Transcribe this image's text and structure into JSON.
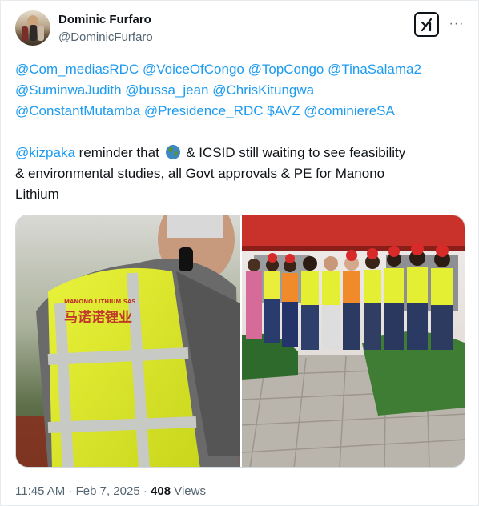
{
  "author": {
    "name": "Dominic Furfaro",
    "handle": "@DominicFurfaro"
  },
  "actions": {
    "grok_icon": "grok-icon",
    "more_icon": "more-icon",
    "more_label": "···"
  },
  "tweet": {
    "lines": [
      [
        {
          "t": "mention",
          "v": "@Com_mediasRDC"
        },
        {
          "t": "text",
          "v": " "
        },
        {
          "t": "mention",
          "v": "@VoiceOfCongo"
        },
        {
          "t": "text",
          "v": " "
        },
        {
          "t": "mention",
          "v": "@TopCongo"
        },
        {
          "t": "text",
          "v": " "
        },
        {
          "t": "mention",
          "v": "@TinaSalama2"
        }
      ],
      [
        {
          "t": "mention",
          "v": "@SuminwaJudith"
        },
        {
          "t": "text",
          "v": " "
        },
        {
          "t": "mention",
          "v": "@bussa_jean"
        },
        {
          "t": "text",
          "v": " "
        },
        {
          "t": "mention",
          "v": "@ChrisKitungwa"
        }
      ],
      [
        {
          "t": "mention",
          "v": "@ConstantMutamba"
        },
        {
          "t": "text",
          "v": " "
        },
        {
          "t": "mention",
          "v": "@Presidence_RDC"
        },
        {
          "t": "text",
          "v": " "
        },
        {
          "t": "mention",
          "v": "$AVZ"
        },
        {
          "t": "text",
          "v": " "
        },
        {
          "t": "mention",
          "v": "@cominiereSA"
        }
      ],
      [],
      [
        {
          "t": "mention",
          "v": "@kizpaka"
        },
        {
          "t": "text",
          "v": " reminder that "
        },
        {
          "t": "emoji",
          "v": "globe-emoji"
        },
        {
          "t": "text",
          "v": " & ICSID still waiting to see feasibility"
        }
      ],
      [
        {
          "t": "text",
          "v": "& environmental studies, all Govt approvals & PE for Manono"
        }
      ],
      [
        {
          "t": "text",
          "v": "Lithium"
        }
      ]
    ]
  },
  "media": {
    "left_vest_text": "马诺诺锂业",
    "left_vest_small": "MANONO LITHIUM SAS"
  },
  "meta": {
    "time": "11:45 AM",
    "sep": " · ",
    "date": "Feb 7, 2025",
    "sep2": " · ",
    "views_count": "408",
    "views_label": " Views"
  },
  "colors": {
    "link": "#1d9bf0",
    "secondary": "#536471",
    "primary": "#0f1419"
  }
}
